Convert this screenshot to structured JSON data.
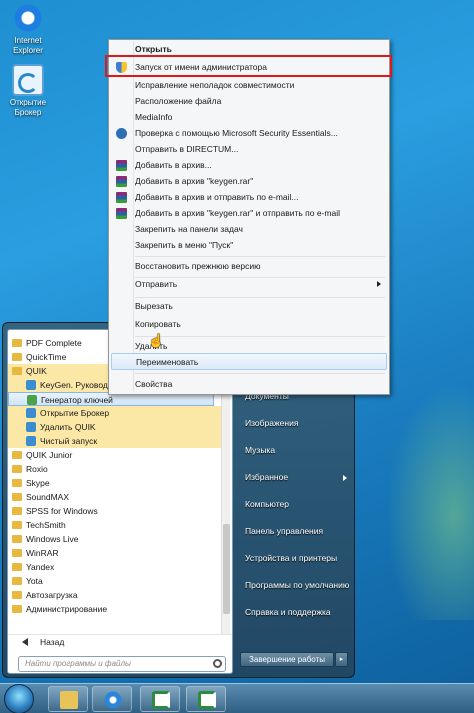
{
  "desktop": {
    "icons": [
      {
        "name": "internet-explorer",
        "label": "Internet Explorer"
      },
      {
        "name": "broker",
        "label": "Открытие Брокер"
      }
    ]
  },
  "context_menu": {
    "items": [
      {
        "label": "Открыть",
        "bold": true
      },
      {
        "label": "Запуск от имени администратора",
        "icon": "shield-icon",
        "highlighted": true
      },
      {
        "label": "Исправление неполадок совместимости"
      },
      {
        "label": "Расположение файла"
      },
      {
        "label": "MediaInfo"
      },
      {
        "label": "Проверка с помощью Microsoft Security Essentials...",
        "icon": "mse-icon"
      },
      {
        "label": "Отправить в DIRECTUM..."
      },
      {
        "label": "Добавить в архив...",
        "icon": "winrar-icon"
      },
      {
        "label": "Добавить в архив \"keygen.rar\"",
        "icon": "winrar-icon"
      },
      {
        "label": "Добавить в архив и отправить по e-mail...",
        "icon": "winrar-icon"
      },
      {
        "label": "Добавить в архив \"keygen.rar\" и отправить по e-mail",
        "icon": "winrar-icon"
      },
      {
        "label": "Закрепить на панели задач"
      },
      {
        "label": "Закрепить в меню \"Пуск\""
      },
      {
        "label": "Восстановить прежнюю версию"
      },
      {
        "label": "Отправить",
        "submenu": true
      },
      {
        "label": "Вырезать"
      },
      {
        "label": "Копировать"
      },
      {
        "label": "Удалить"
      },
      {
        "label": "Переименовать",
        "hover": true
      },
      {
        "label": "Свойства"
      }
    ]
  },
  "start_menu": {
    "programs": [
      {
        "label": "PDF Complete",
        "kind": "folder"
      },
      {
        "label": "QuickTime",
        "kind": "folder"
      },
      {
        "label": "QUIK",
        "kind": "folder",
        "state": "highlighted"
      },
      {
        "label": "KeyGen. Руководство",
        "kind": "sub",
        "state": "highlighted"
      },
      {
        "label": "Генератор ключей",
        "kind": "sub",
        "state": "current"
      },
      {
        "label": "Открытие Брокер",
        "kind": "sub",
        "state": "highlighted"
      },
      {
        "label": "Удалить QUIK",
        "kind": "sub",
        "state": "highlighted"
      },
      {
        "label": "Чистый запуск",
        "kind": "sub",
        "state": "highlighted"
      },
      {
        "label": "QUIK Junior",
        "kind": "folder"
      },
      {
        "label": "Roxio",
        "kind": "folder"
      },
      {
        "label": "Skype",
        "kind": "folder"
      },
      {
        "label": "SoundMAX",
        "kind": "folder"
      },
      {
        "label": "SPSS for Windows",
        "kind": "folder"
      },
      {
        "label": "TechSmith",
        "kind": "folder"
      },
      {
        "label": "Windows Live",
        "kind": "folder"
      },
      {
        "label": "WinRAR",
        "kind": "folder"
      },
      {
        "label": "Yandex",
        "kind": "folder"
      },
      {
        "label": "Yota",
        "kind": "folder"
      },
      {
        "label": "Автозагрузка",
        "kind": "folder"
      },
      {
        "label": "Администрирование",
        "kind": "folder"
      }
    ],
    "back_label": "Назад",
    "search_placeholder": "Найти программы и файлы",
    "right_items": [
      {
        "label": "Документы"
      },
      {
        "label": "Изображения"
      },
      {
        "label": "Музыка"
      },
      {
        "label": "Избранное",
        "submenu": true
      },
      {
        "label": "Компьютер"
      },
      {
        "label": "Панель управления"
      },
      {
        "label": "Устройства и принтеры"
      },
      {
        "label": "Программы по умолчанию"
      },
      {
        "label": "Справка и поддержка"
      }
    ],
    "shutdown_label": "Завершение работы",
    "shutdown_arrow": "▸"
  },
  "taskbar": {
    "buttons": [
      "start-orb",
      "windows-explorer-icon",
      "internet-explorer-icon",
      "quik-icon",
      "quik-icon"
    ]
  },
  "cursor_glyph": "☝"
}
